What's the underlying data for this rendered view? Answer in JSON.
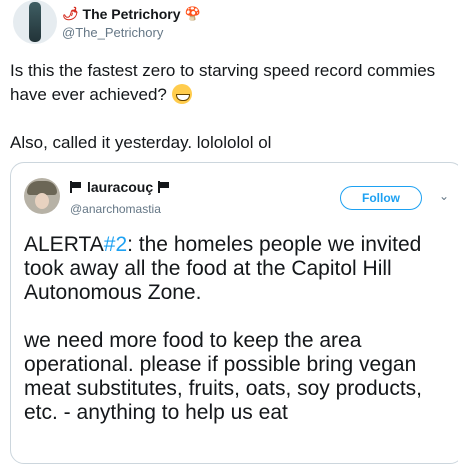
{
  "author": {
    "name": "The Petrichory",
    "handle": "@The_Petrichory",
    "name_prefix_icon": "hot-pepper-icon",
    "name_suffix_icon": "mushroom-icon"
  },
  "tweet": {
    "line1": "Is this the fastest zero to starving speed record commies have ever achieved?",
    "line1_emoji": "grinning-face-with-sweat-icon",
    "line2": "Also, called it yesterday. lolololol ol"
  },
  "quoted": {
    "name": "lauracouç",
    "handle": "@anarchomastia",
    "follow_label": "Follow",
    "flag_icon": "black-flag-icon",
    "text_para1_prefix": "ALERTA",
    "text_para1_hashtag": "#2",
    "text_para1_rest": ": the homeles people we invited took away all the food at the Capitol Hill Autonomous Zone.",
    "text_para2": "we need more food to keep the area operational. please if possible bring vegan meat substitutes, fruits, oats, soy products, etc. - anything to help us eat"
  },
  "colors": {
    "accent": "#1da1f2",
    "secondary_text": "#657786",
    "border": "#ccd6dd"
  }
}
